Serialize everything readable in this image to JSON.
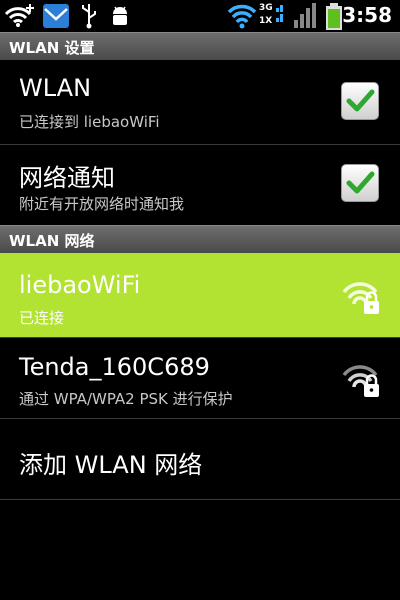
{
  "status_bar": {
    "time": "3:58",
    "network_type_top": "3G",
    "network_type_bottom": "1X",
    "icons": [
      "wifi-plus-icon",
      "mail-icon",
      "usb-icon",
      "android-debug-icon",
      "wifi-icon",
      "cell-signal-icon",
      "battery-icon"
    ]
  },
  "header": {
    "title": "WLAN 设置"
  },
  "wlan_toggle": {
    "title": "WLAN",
    "subtitle": "已连接到 liebaoWiFi",
    "checked": true
  },
  "network_notify": {
    "title": "网络通知",
    "subtitle": "附近有开放网络时通知我",
    "checked": true
  },
  "networks_header": {
    "title": "WLAN 网络"
  },
  "networks": [
    {
      "ssid": "liebaoWiFi",
      "status": "已连接",
      "secured": true,
      "selected": true
    },
    {
      "ssid": "Tenda_160C689",
      "status": "通过 WPA/WPA2 PSK 进行保护",
      "secured": true,
      "selected": false
    }
  ],
  "add_network": {
    "label": "添加 WLAN 网络"
  },
  "colors": {
    "accent_selected": "#b2e232",
    "check": "#2fa82f",
    "header_bg": "#5a5a5a"
  }
}
